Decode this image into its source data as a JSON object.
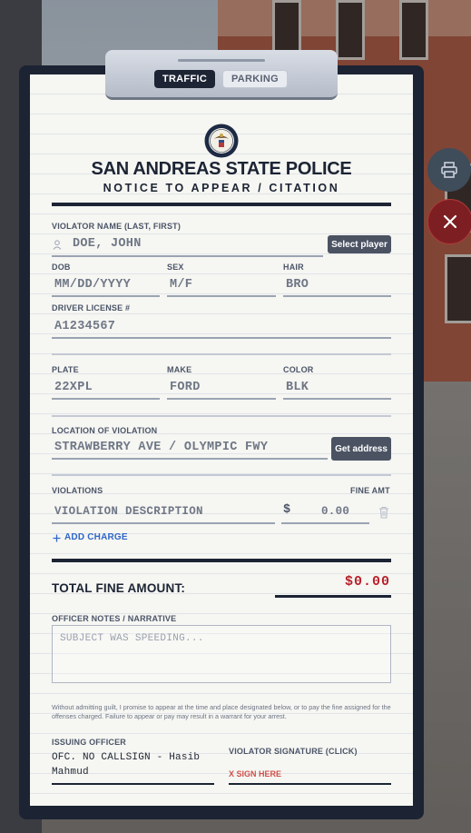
{
  "tabs": [
    {
      "label": "TRAFFIC",
      "active": true
    },
    {
      "label": "PARKING",
      "active": false
    }
  ],
  "header": {
    "agency": "SAN ANDREAS STATE POLICE",
    "subtitle": "NOTICE TO APPEAR / CITATION"
  },
  "violator": {
    "name_label": "VIOLATOR NAME (LAST, FIRST)",
    "name_placeholder": "DOE, JOHN",
    "select_player": "Select player",
    "dob_label": "DOB",
    "dob_placeholder": "MM/DD/YYYY",
    "sex_label": "SEX",
    "sex_placeholder": "M/F",
    "hair_label": "HAIR",
    "hair_placeholder": "BRO",
    "license_label": "DRIVER LICENSE #",
    "license_placeholder": "A1234567"
  },
  "vehicle": {
    "plate_label": "PLATE",
    "plate_placeholder": "22XPL",
    "make_label": "MAKE",
    "make_placeholder": "FORD",
    "color_label": "COLOR",
    "color_placeholder": "BLK"
  },
  "location": {
    "label": "LOCATION OF VIOLATION",
    "placeholder": "STRAWBERRY AVE / OLYMPIC FWY",
    "get_address": "Get address"
  },
  "violations": {
    "label": "VIOLATIONS",
    "fine_label": "FINE AMT",
    "description_placeholder": "VIOLATION DESCRIPTION",
    "currency": "$",
    "fine_placeholder": "0.00",
    "add_charge": "ADD CHARGE"
  },
  "total": {
    "label": "TOTAL FINE AMOUNT:",
    "value": "$0.00"
  },
  "notes": {
    "label": "OFFICER NOTES / NARRATIVE",
    "placeholder": "SUBJECT WAS SPEEDING..."
  },
  "disclaimer": "Without admitting guilt, I promise to appear at the time and place designated below, or to pay the fine assigned for the offenses charged. Failure to appear or pay may result in a warrant for your arrest.",
  "signatures": {
    "officer_label": "ISSUING OFFICER",
    "officer_name": "OFC. NO CALLSIGN - Hasib Mahmud",
    "violator_label": "VIOLATOR SIGNATURE (CLICK)",
    "sign_here": "X SIGN HERE"
  },
  "icons": [
    "print-icon",
    "close-icon",
    "person-icon",
    "trash-icon",
    "plus-icon",
    "seal-emblem"
  ],
  "colors": {
    "frame": "#1c2434",
    "paper": "#f6f6f2",
    "accent_blue": "#2f67c9",
    "total_red": "#b8202a",
    "close_red": "#7d1f22"
  }
}
